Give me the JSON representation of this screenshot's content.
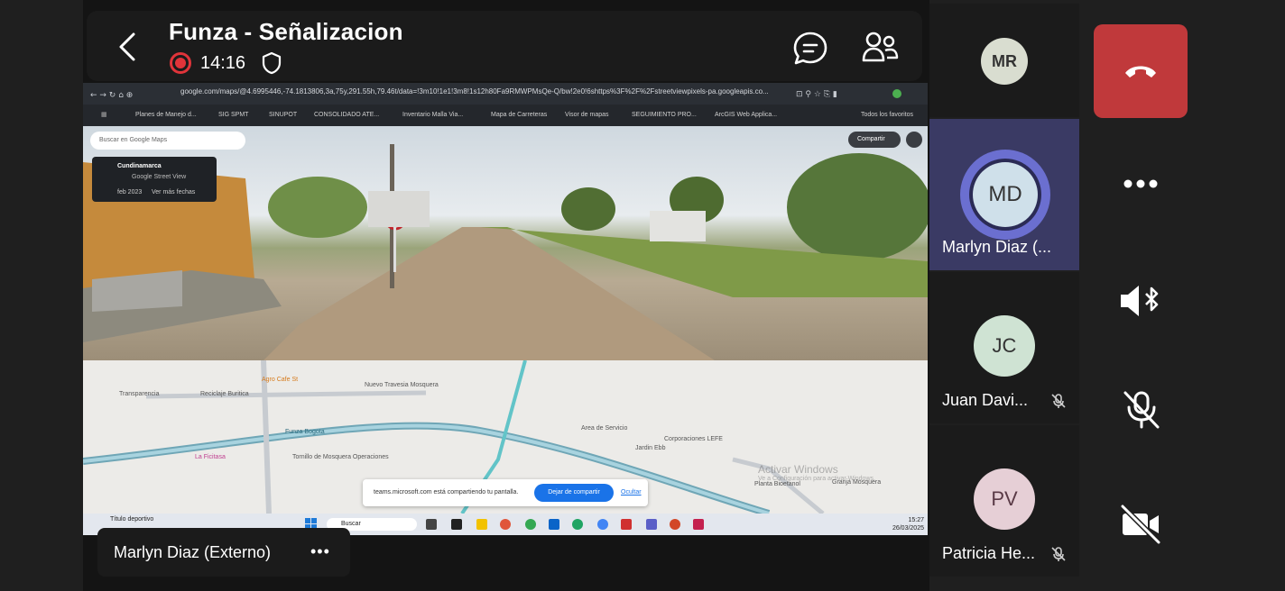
{
  "meeting": {
    "title": "Funza - Señalizacion",
    "timer": "14:16"
  },
  "share": {
    "url": "google.com/maps/@4.6995446,-74.1813806,3a,75y,291.55h,79.46t/data=!3m10!1e1!3m8!1s12h80Fa9RMWPMsQe-Q/bw!2e0!6shttps%3F%2F%2Fstreetviewpixels-pa.googleapis.co...",
    "bookmarks": [
      "Planes de Manejo d...",
      "SIG SPMT",
      "SINUPOT",
      "CONSOLIDADO ATE...",
      "Inventario Malla Via...",
      "Mapa de Carreteras",
      "Visor de mapas",
      "SEGUIMIENTO PRO...",
      "ArcGIS Web Applica...",
      "Todos los favoritos"
    ],
    "search_placeholder": "Buscar en Google Maps",
    "place_name": "Cundinamarca",
    "place_sub": "Google Street View",
    "place_date": "feb 2023",
    "place_more": "Ver más fechas",
    "share_label": "Compartir",
    "map_labels": [
      "Transparencia",
      "Reciclaje Buritica",
      "Agro Cafe St",
      "Nuevo Travesia Mosquera",
      "Tornillo de Mosquera Operaciones",
      "La Ficitasa",
      "Area de Servicio",
      "Jardin Ebb",
      "Corporaciones LEFE",
      "Planta Bioetanol",
      "Granja Mosquera"
    ],
    "road_label": "Funza Bogota",
    "notice_text": "teams.microsoft.com está compartiendo tu pantalla.",
    "notice_stop": "Dejar de compartir",
    "notice_hide": "Ocultar",
    "watermark": "Activar Windows",
    "watermark_sub": "Ve a Configuración para activar Windows.",
    "task_weather_title": "Título deportivo",
    "task_search": "Buscar",
    "task_time": "15:27",
    "task_date": "26/03/2025"
  },
  "presenter": {
    "name": "Marlyn Diaz (Externo)"
  },
  "participants": [
    {
      "initials": "MR",
      "name": "",
      "avatar_color": "#d9ddd0"
    },
    {
      "initials": "MD",
      "name": "Marlyn Diaz (...",
      "avatar_color": "#cfe0ea",
      "speaking": true
    },
    {
      "initials": "JC",
      "name": "Juan Davi...",
      "avatar_color": "#cfe3d3",
      "muted": true
    },
    {
      "initials": "PV",
      "name": "Patricia He...",
      "avatar_color": "#e6cfd6",
      "muted": true
    }
  ],
  "controls": {
    "end_call_color": "#c0393b"
  }
}
